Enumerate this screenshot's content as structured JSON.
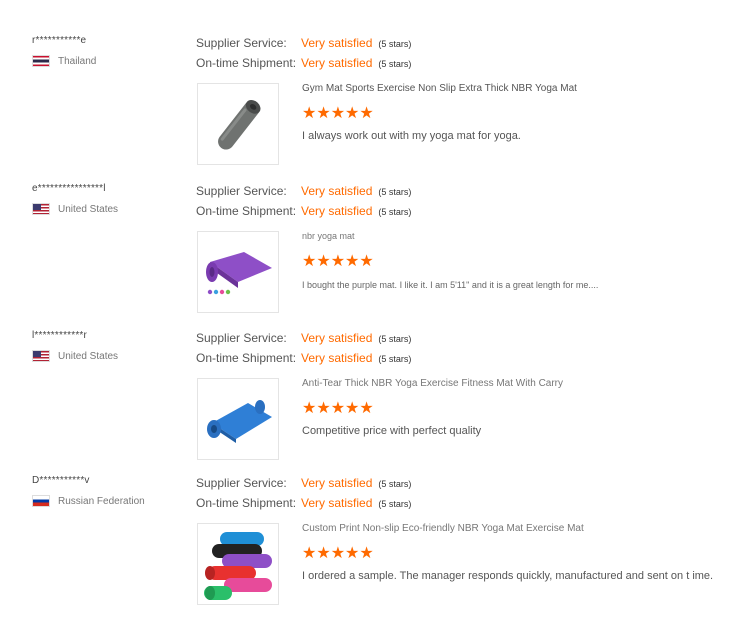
{
  "reviews": [
    {
      "user": "r***********e",
      "country": "Thailand",
      "flag": "flag-th",
      "supplier_service_label": "Supplier Service:",
      "supplier_service_value": "Very satisfied",
      "supplier_service_stars": "(5 stars)",
      "shipment_label": "On-time Shipment:",
      "shipment_value": "Very satisfied",
      "shipment_stars": "(5 stars)",
      "product_title": "Gym Mat Sports Exercise Non Slip Extra Thick NBR Yoga Mat",
      "product_rating": 5,
      "stars_text": "★★★★★",
      "comment": "I always work out with my yoga mat for yoga.",
      "product_image": "grey-rolled-yoga-mat"
    },
    {
      "user": "e****************l",
      "country": "United States",
      "flag": "flag-us",
      "supplier_service_label": "Supplier Service:",
      "supplier_service_value": "Very satisfied",
      "supplier_service_stars": "(5 stars)",
      "shipment_label": "On-time Shipment:",
      "shipment_value": "Very satisfied",
      "shipment_stars": "(5 stars)",
      "product_title": "nbr yoga mat",
      "product_rating": 5,
      "stars_text": "★★★★★",
      "comment": "I bought the purple mat. I like it. I am 5'11\" and it is a great length for me....",
      "product_image": "purple-yoga-mat"
    },
    {
      "user": "l************r",
      "country": "United States",
      "flag": "flag-us",
      "supplier_service_label": "Supplier Service:",
      "supplier_service_value": "Very satisfied",
      "supplier_service_stars": "(5 stars)",
      "shipment_label": "On-time Shipment:",
      "shipment_value": "Very satisfied",
      "shipment_stars": "(5 stars)",
      "product_title": "Anti-Tear Thick NBR Yoga Exercise Fitness Mat With Carry",
      "product_rating": 5,
      "stars_text": "★★★★★",
      "comment": "Competitive price with perfect quality",
      "product_image": "blue-yoga-mat"
    },
    {
      "user": "D***********v",
      "country": "Russian Federation",
      "flag": "flag-ru",
      "supplier_service_label": "Supplier Service:",
      "supplier_service_value": "Very satisfied",
      "supplier_service_stars": "(5 stars)",
      "shipment_label": "On-time Shipment:",
      "shipment_value": "Very satisfied",
      "shipment_stars": "(5 stars)",
      "product_title": "Custom Print Non-slip Eco-friendly NBR Yoga Mat Exercise Mat",
      "product_rating": 5,
      "stars_text": "★★★★★",
      "comment": "I ordered a sample. The manager responds quickly, manufactured and sent on t ime.",
      "product_image": "stacked-colorful-yoga-mats"
    }
  ],
  "colors": {
    "accent": "#ff6a00",
    "border": "#e4e4e4"
  }
}
